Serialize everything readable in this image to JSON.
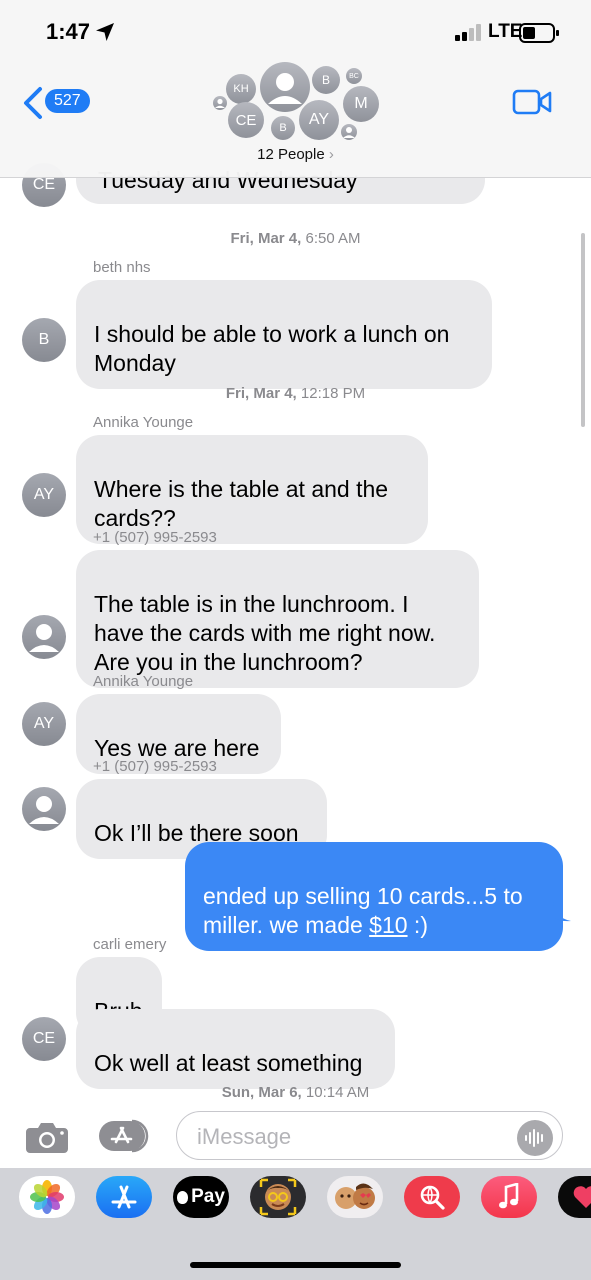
{
  "status_bar": {
    "time": "1:47",
    "carrier": "LTE"
  },
  "header": {
    "back_count": "527",
    "participants_label": "12 People",
    "avatars": [
      "KH",
      "B",
      "BC",
      "M",
      "CE",
      "B",
      "AY"
    ]
  },
  "messages": {
    "ce_top_initials": "CE",
    "ce_top_text": "Tuesday and Wednesday",
    "ts1_day": "Fri, Mar 4,",
    "ts1_time": "6:50 AM",
    "sender_beth": "beth nhs",
    "beth_initial": "B",
    "beth_text": "I should be able to work a lunch on\nMonday",
    "ts2_day": "Fri, Mar 4,",
    "ts2_time": "12:18 PM",
    "sender_annika_1": "Annika Younge",
    "ay_initials_1": "AY",
    "annika_text_1": "Where is the table at and the\ncards??",
    "sender_phone_1": "+1 (507) 995-2593",
    "phone_text_1": "The table is in the lunchroom. I\nhave the cards with me right now.\nAre you in the lunchroom?",
    "sender_annika_2": "Annika Younge",
    "ay_initials_2": "AY",
    "annika_text_2": "Yes we are here",
    "sender_phone_2": "+1 (507) 995-2593",
    "phone_text_2": "Ok I’ll be there soon",
    "out_text_1": "ended up selling 10 cards...5 to\nmiller. we made ",
    "out_link": "$10",
    "out_text_2": " :)",
    "sender_carli": "carli emery",
    "carli_text_1": "Bruh",
    "carli_text_2": "Ok well at least something",
    "carli_initials": "CE",
    "ts3_day": "Sun, Mar 6,",
    "ts3_time": "10:14 AM"
  },
  "compose": {
    "placeholder": "iMessage"
  },
  "app_strip": {
    "items": [
      "photos-icon",
      "app-store-icon",
      "apple-pay-icon",
      "memoji-icon",
      "memoji-stickers-icon",
      "web-search-icon",
      "music-icon",
      "digital-touch-icon"
    ],
    "apple_pay_label": "Pay"
  },
  "colors": {
    "outgoing_bubble": "#3b88f5",
    "incoming_bubble": "#e9e9eb",
    "accent": "#1f7cf5"
  }
}
